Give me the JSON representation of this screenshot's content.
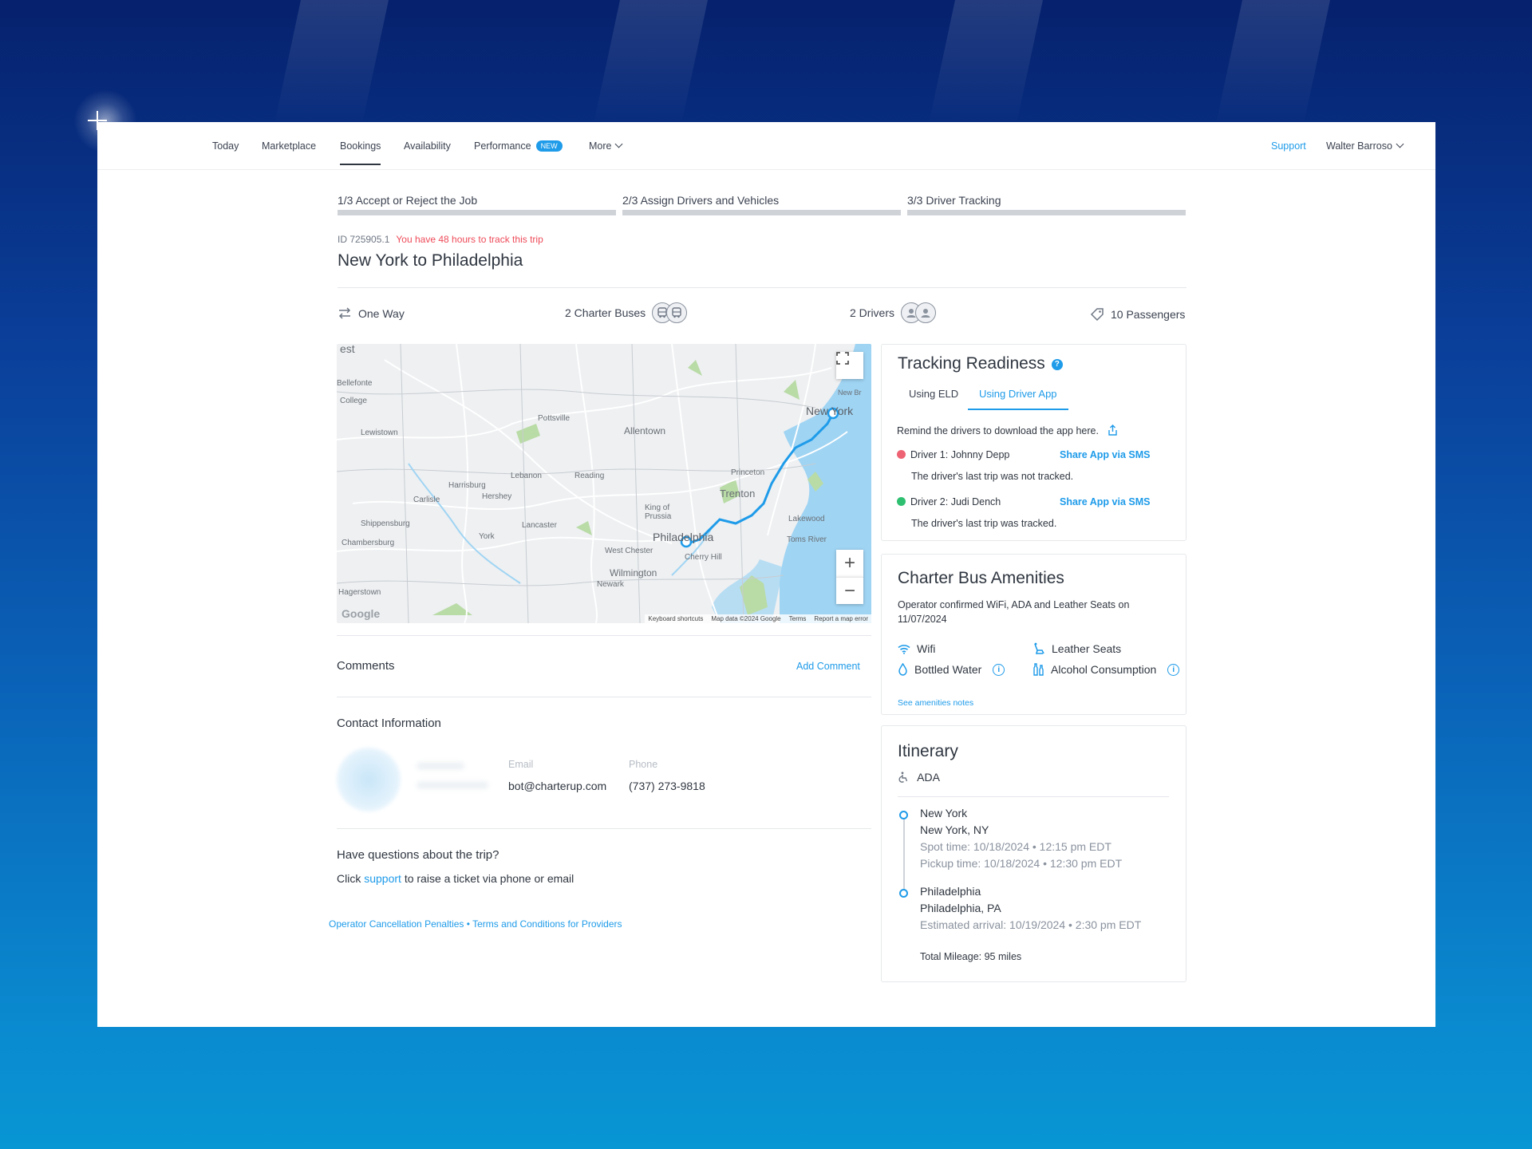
{
  "nav": {
    "items": [
      {
        "label": "Today"
      },
      {
        "label": "Marketplace"
      },
      {
        "label": "Bookings"
      },
      {
        "label": "Availability"
      },
      {
        "label": "Performance"
      },
      {
        "label": "More"
      }
    ],
    "new_badge": "NEW",
    "support": "Support",
    "user": "Walter Barroso"
  },
  "steps": [
    {
      "label": "1/3 Accept or Reject the Job"
    },
    {
      "label": "2/3 Assign Drivers and Vehicles"
    },
    {
      "label": "3/3 Driver Tracking"
    }
  ],
  "trip": {
    "id_label": "ID",
    "id": "725905.1",
    "warning": "You have 48 hours to track this trip",
    "title": "New York to Philadelphia"
  },
  "summary": {
    "trip_type": "One Way",
    "buses": "2 Charter Buses",
    "drivers": "2 Drivers",
    "passengers": "10 Passengers"
  },
  "map": {
    "labels": {
      "new_york": "New York",
      "allentown": "Allentown",
      "pottsville": "Pottsville",
      "lewistown": "Lewistown",
      "bellefonte": "Bellefonte",
      "college": "College",
      "harrisburg": "Harrisburg",
      "hershey": "Hershey",
      "lebanon": "Lebanon",
      "reading": "Reading",
      "carlisle": "Carlisle",
      "princeton": "Princeton",
      "trenton": "Trenton",
      "king_of_prussia": "King of Prussia",
      "lancaster": "Lancaster",
      "shippensburg": "Shippensburg",
      "chambersburg": "Chambersburg",
      "york": "York",
      "philadelphia": "Philadelphia",
      "west_chester": "West Chester",
      "cherry_hill": "Cherry Hill",
      "lakewood": "Lakewood",
      "toms_river": "Toms River",
      "wilmington": "Wilmington",
      "newark": "Newark",
      "hagerstown": "Hagerstown",
      "new_brunswick": "New Br"
    },
    "footer": {
      "shortcuts": "Keyboard shortcuts",
      "data": "Map data ©2024 Google",
      "terms": "Terms",
      "report": "Report a map error"
    },
    "google": "Google"
  },
  "comments": {
    "title": "Comments",
    "add": "Add Comment"
  },
  "contact": {
    "title": "Contact Information",
    "email_label": "Email",
    "email": "bot@charterup.com",
    "phone_label": "Phone",
    "phone": "(737) 273-9818"
  },
  "questions": {
    "title": "Have questions about the trip?",
    "prefix": "Click",
    "link": "support",
    "suffix": "to raise a ticket via phone or email"
  },
  "footer_links": {
    "penalties": "Operator Cancellation Penalties",
    "separator": "•",
    "terms": "Terms and Conditions for Providers"
  },
  "tracking": {
    "title": "Tracking Readiness",
    "tabs": [
      {
        "label": "Using ELD"
      },
      {
        "label": "Using Driver App"
      }
    ],
    "remind": "Remind the drivers to download the app here.",
    "drivers": [
      {
        "name": "Driver 1: Johnny Depp",
        "share": "Share App via SMS",
        "status": "The driver's last trip was not tracked.",
        "color": "#ee6373"
      },
      {
        "name": "Driver 2: Judi Dench",
        "share": "Share App via SMS",
        "status": "The driver's last trip was tracked.",
        "color": "#2fbf71"
      }
    ]
  },
  "amenities": {
    "title": "Charter Bus Amenities",
    "desc": "Operator confirmed WiFi, ADA and Leather Seats on 11/07/2024",
    "items": [
      {
        "label": "Wifi",
        "icon": "wifi-icon"
      },
      {
        "label": "Leather Seats",
        "icon": "seat-icon"
      },
      {
        "label": "Bottled Water",
        "icon": "water-drop-icon"
      },
      {
        "label": "Alcohol Consumption",
        "icon": "bottles-icon"
      }
    ],
    "notes": "See amenities notes"
  },
  "itinerary": {
    "title": "Itinerary",
    "ada": "ADA",
    "stops": [
      {
        "name": "New York",
        "city": "New York, NY",
        "line1": "Spot time: 10/18/2024 • 12:15 pm EDT",
        "line2": "Pickup time: 10/18/2024 • 12:30 pm EDT"
      },
      {
        "name": "Philadelphia",
        "city": "Philadelphia, PA",
        "line1": "Estimated arrival: 10/19/2024 • 2:30 pm EDT"
      }
    ],
    "mileage": "Total Mileage: 95 miles"
  },
  "colors": {
    "accent": "#1e9be9",
    "warning": "#ee4b59"
  }
}
